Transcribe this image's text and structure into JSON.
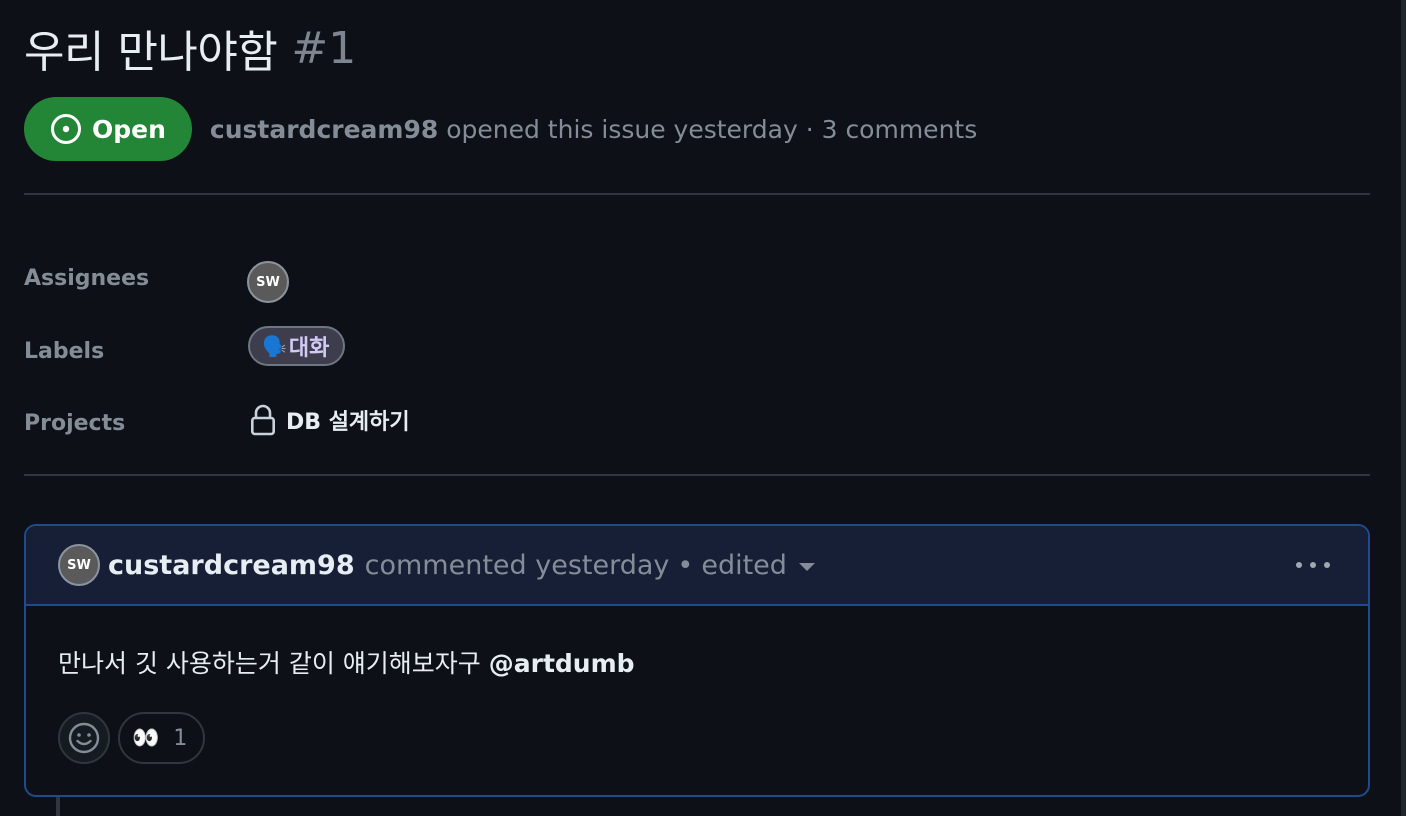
{
  "issue": {
    "title": "우리 만나야함",
    "number": "#1",
    "state": "Open",
    "author": "custardcream98",
    "meta_text": "opened this issue yesterday · 3 comments"
  },
  "sidebar": {
    "assignees_label": "Assignees",
    "labels_label": "Labels",
    "projects_label": "Projects",
    "assignee_avatar_text": "SW",
    "label": {
      "emoji": "🗣️",
      "name": "대화"
    },
    "project_name": "DB 설계하기"
  },
  "comment": {
    "author": "custardcream98",
    "action": "commented yesterday",
    "separator": "•",
    "edited": "edited",
    "avatar_text": "SW",
    "body_text": "만나서 깃 사용하는거 같이 얘기해보자구 ",
    "mention": "@artdumb",
    "reactions": [
      {
        "emoji": "👀",
        "count": "1"
      }
    ]
  },
  "colors": {
    "background": "#0d1117",
    "open_badge": "#238636",
    "comment_border": "#1f4b8e",
    "comment_header": "#161f36",
    "muted_text": "#848d97"
  }
}
